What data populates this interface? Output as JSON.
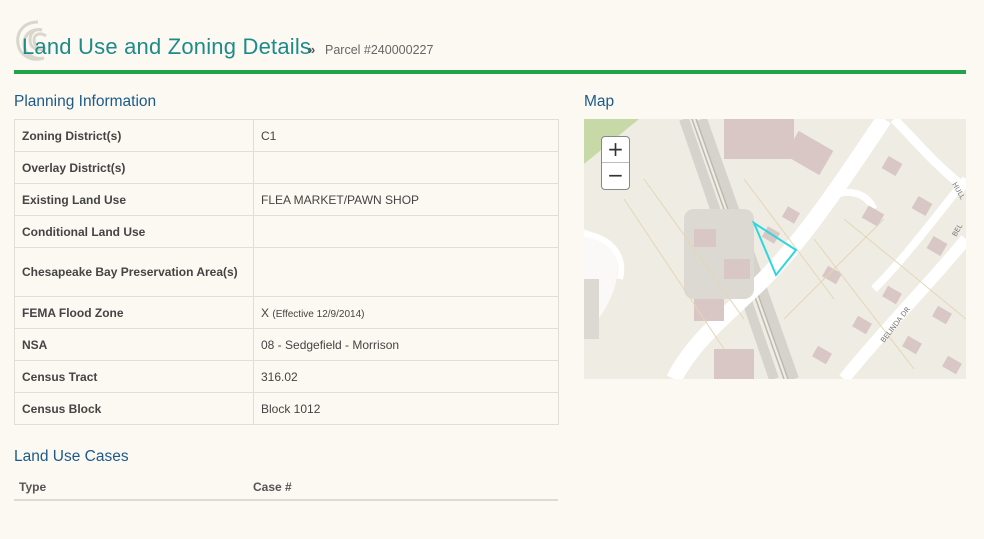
{
  "header": {
    "title": "Land Use and Zoning Details",
    "separator": "»",
    "parcel": "Parcel #240000227"
  },
  "planning": {
    "title": "Planning Information",
    "rows": [
      {
        "label": "Zoning District(s)",
        "value": "C1"
      },
      {
        "label": "Overlay District(s)",
        "value": ""
      },
      {
        "label": "Existing Land Use",
        "value": "FLEA MARKET/PAWN SHOP"
      },
      {
        "label": "Conditional Land Use",
        "value": ""
      },
      {
        "label": "Chesapeake Bay Preservation Area(s)",
        "value": ""
      },
      {
        "label": "FEMA Flood Zone",
        "value": "X",
        "note": "(Effective 12/9/2014)"
      },
      {
        "label": "NSA",
        "value": "08 - Sedgefield - Morrison"
      },
      {
        "label": "Census Tract",
        "value": "316.02"
      },
      {
        "label": "Census Block",
        "value": "Block 1012"
      }
    ]
  },
  "map": {
    "title": "Map",
    "zoom_in": "+",
    "zoom_out": "−",
    "street_labels": [
      "BELINDA DR",
      "HULL",
      "BEL"
    ],
    "parcel_outline_color": "#2fd6de"
  },
  "cases": {
    "title": "Land Use Cases",
    "columns": [
      "Type",
      "Case #"
    ]
  },
  "colors": {
    "title_teal": "#1f8a8a",
    "section_blue": "#1d5a8a",
    "rule_green": "#21a24c",
    "background": "#fbf9f1"
  }
}
